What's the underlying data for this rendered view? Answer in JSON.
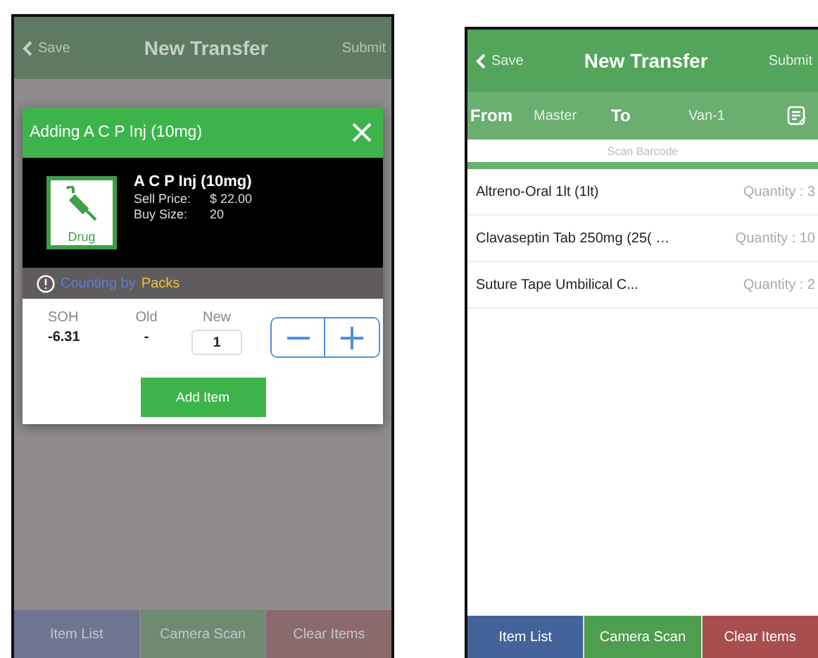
{
  "dimmed_screen": {
    "nav": {
      "back": "Save",
      "title": "New Transfer",
      "action": "Submit"
    },
    "bottom_buttons": [
      {
        "label": "Item List",
        "color": "#6e7590"
      },
      {
        "label": "Camera Scan",
        "color": "#6f8a70"
      },
      {
        "label": "Clear Items",
        "color": "#8a6a6d"
      }
    ]
  },
  "dialog": {
    "title": "Adding A C P Inj (10mg)",
    "product": {
      "badge": "Drug",
      "name": "A C P Inj (10mg)",
      "details": [
        {
          "label": "Sell Price:",
          "value": "$ 22.00"
        },
        {
          "label": "Buy Size:",
          "value": "20"
        }
      ]
    },
    "counting": {
      "prefix": "Counting by",
      "unit": "Packs"
    },
    "stock": [
      {
        "label": "SOH",
        "value": "-6.31"
      },
      {
        "label": "Old",
        "value": "-"
      }
    ],
    "new": {
      "label": "New",
      "value": "1"
    },
    "add_button": "Add Item"
  },
  "screen": {
    "nav": {
      "back": "Save",
      "title": "New Transfer",
      "action": "Submit"
    },
    "transfer": {
      "from_label": "From",
      "from": "Master",
      "to_label": "To",
      "to": "Van-1"
    },
    "scan": {
      "placeholder": "Scan Barcode"
    },
    "items": [
      {
        "name": "Altreno-Oral 1lt (1lt)",
        "quantity": "Quantity : 3"
      },
      {
        "name": "Clavaseptin Tab 250mg (25( …",
        "quantity": "Quantity : 10"
      },
      {
        "name": "Suture Tape Umbilical C...",
        "quantity": "Quantity : 2"
      }
    ],
    "bottom_buttons": [
      {
        "label": "Item List",
        "color": "#44639b"
      },
      {
        "label": "Camera Scan",
        "color": "#4e9e4f"
      },
      {
        "label": "Clear Items",
        "color": "#a84e4e"
      }
    ]
  }
}
